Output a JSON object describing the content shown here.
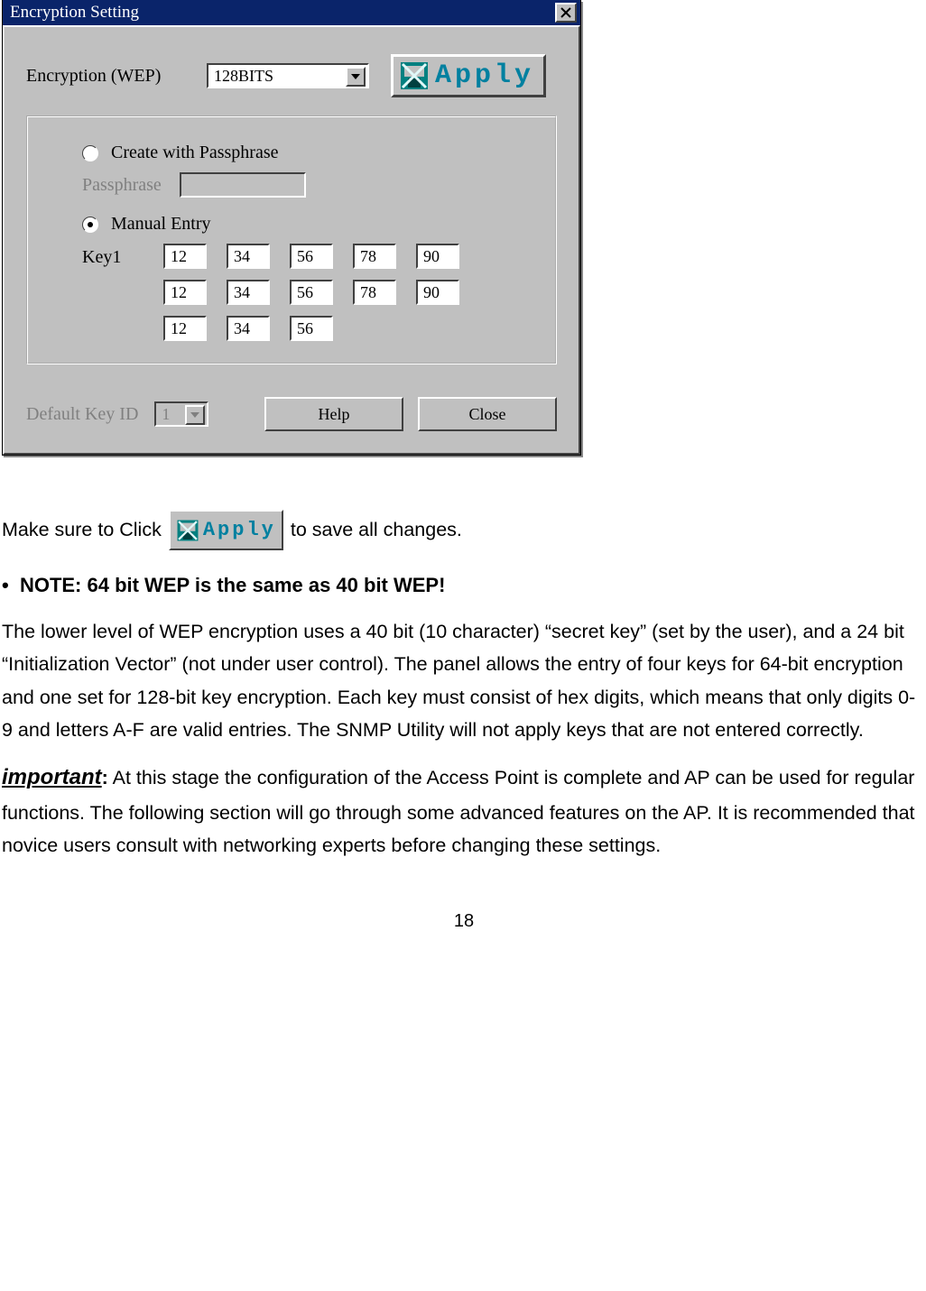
{
  "dialog": {
    "title": "Encryption Setting",
    "encryption_label": "Encryption (WEP)",
    "encryption_value": "128BITS",
    "apply_label": "Apply",
    "opt_passphrase": "Create with Passphrase",
    "passphrase_label": "Passphrase",
    "opt_manual": "Manual Entry",
    "key_label": "Key1",
    "key_rows": [
      [
        "12",
        "34",
        "56",
        "78",
        "90"
      ],
      [
        "12",
        "34",
        "56",
        "78",
        "90"
      ],
      [
        "12",
        "34",
        "56"
      ]
    ],
    "default_key_label": "Default Key ID",
    "default_key_value": "1",
    "help_label": "Help",
    "close_label": "Close"
  },
  "body": {
    "click_pre": "Make sure to Click",
    "click_post": "to save all changes.",
    "note": "NOTE: 64 bit WEP is the same as 40 bit WEP!",
    "para1": "The lower level of WEP encryption uses a 40 bit (10 character) “secret key” (set by the user), and a 24 bit “Initialization Vector” (not under user control). The panel allows the entry of four keys for 64-bit encryption and one set for 128-bit key encryption. Each key must consist of hex digits, which means that only digits 0-9 and letters A-F are valid entries. The SNMP Utility will not apply keys that are not entered correctly.",
    "important_label": "important",
    "para2": "At this stage the configuration of the Access Point is complete and AP can be used for regular functions. The following section will go through some advanced features on the AP. It is recommended that novice users consult with networking experts before changing these settings.",
    "page_number": "18"
  }
}
